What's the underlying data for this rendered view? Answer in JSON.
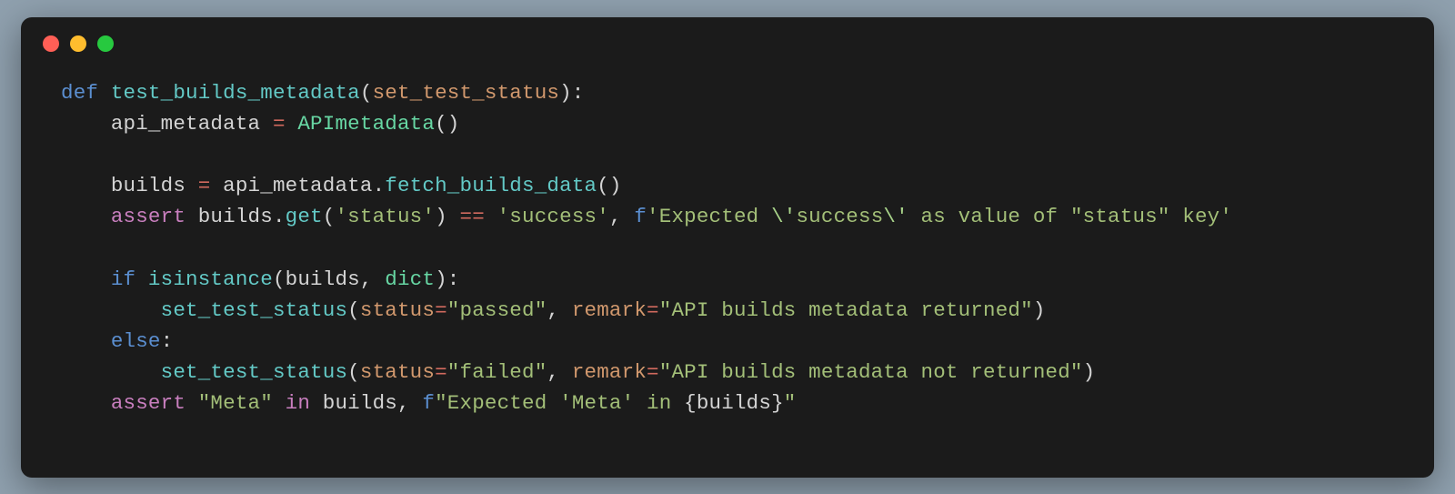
{
  "window": {
    "dots": [
      "red",
      "yellow",
      "green"
    ]
  },
  "code": {
    "l1": {
      "def": "def",
      "fn": "test_builds_metadata",
      "param": "set_test_status"
    },
    "l2": {
      "var": "api_metadata",
      "eq": "=",
      "cls": "APImetadata"
    },
    "l3": {
      "var": "builds",
      "eq": "=",
      "obj": "api_metadata",
      "method": "fetch_builds_data"
    },
    "l4": {
      "assert": "assert",
      "obj": "builds",
      "method": "get",
      "arg1": "'status'",
      "eqeq": "==",
      "arg2": "'success'",
      "fpfx": "f",
      "fstr1": "'Expected ",
      "esc1": "\\'",
      "fmid": "success",
      "esc2": "\\'",
      "fstr2": " as value of \"status\" key'"
    },
    "l5": {
      "if": "if",
      "isinst": "isinstance",
      "arg1": "builds",
      "dict": "dict"
    },
    "l6": {
      "fn": "set_test_status",
      "kw1": "status",
      "val1": "\"passed\"",
      "kw2": "remark",
      "val2": "\"API builds metadata returned\""
    },
    "l7": {
      "else": "else"
    },
    "l8": {
      "fn": "set_test_status",
      "kw1": "status",
      "val1": "\"failed\"",
      "kw2": "remark",
      "val2": "\"API builds metadata not returned\""
    },
    "l9": {
      "assert": "assert",
      "str1": "\"Meta\"",
      "in": "in",
      "obj": "builds",
      "fpfx": "f",
      "fstr1": "\"Expected 'Meta' in ",
      "lb": "{",
      "inner": "builds",
      "rb": "}",
      "fstr2": "\""
    }
  }
}
